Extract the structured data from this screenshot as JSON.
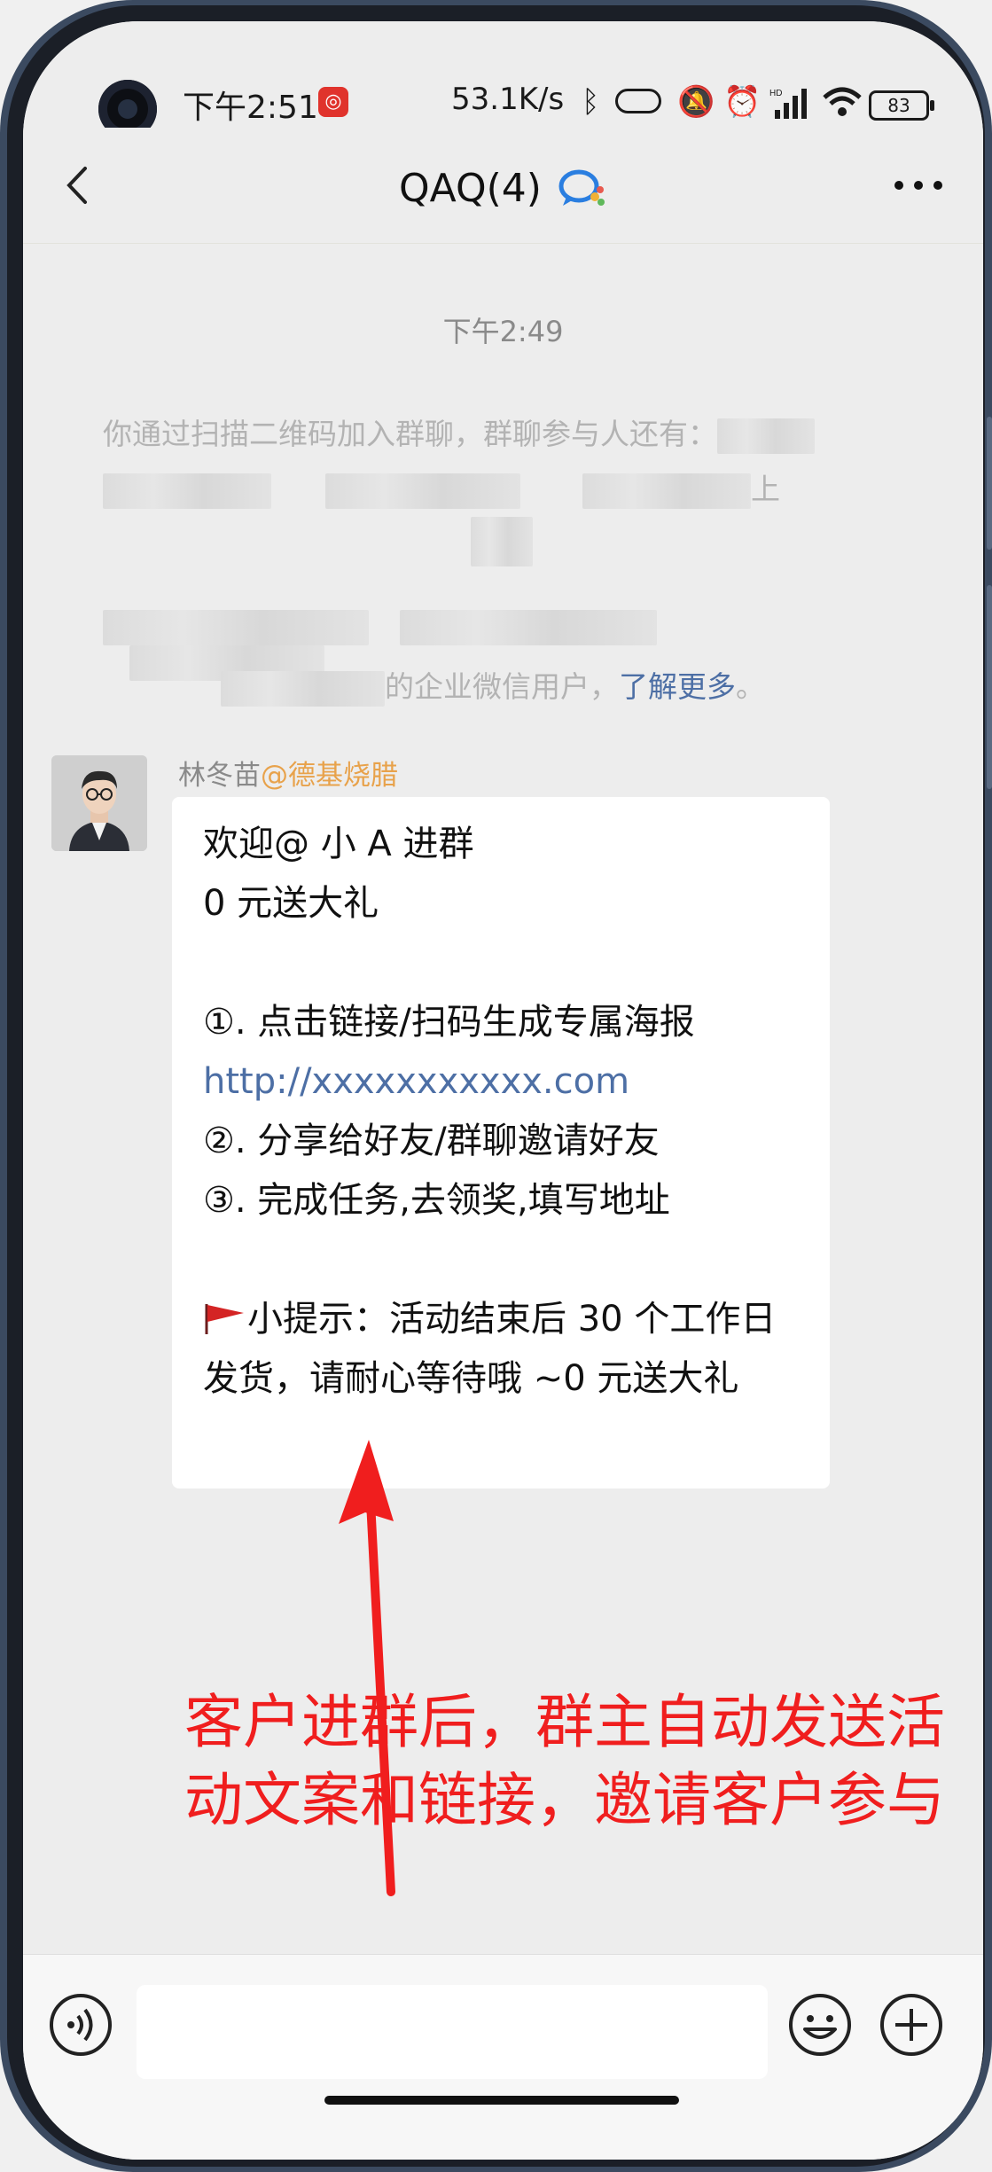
{
  "status_bar": {
    "time": "下午2:51",
    "net_speed": "53.1K/s",
    "battery": "83",
    "icons": [
      "camera-icon",
      "netease-music-icon",
      "bluetooth-icon",
      "vibrate-icon",
      "mute-icon",
      "alarm-icon",
      "signal-icon",
      "wifi-icon",
      "battery-icon"
    ]
  },
  "header": {
    "title": "QAQ(4)",
    "icons": [
      "back-icon",
      "wecom-icon",
      "more-icon"
    ]
  },
  "chat": {
    "timestamp": "下午2:49",
    "system_message": {
      "line1": "你通过扫描二维码加入群聊，群聊参与人还有：",
      "line2_tail": "上",
      "line3_text": "的企业微信用户，",
      "learn_more": "了解更多",
      "period": "。"
    },
    "message": {
      "sender_name": "林冬苗",
      "sender_corp": "@德基烧腊",
      "lines": {
        "l1": "欢迎@ 小 A 进群",
        "l2": "0 元送大礼",
        "l3": "①. 点击链接/扫码生成专属海报",
        "link": "http://xxxxxxxxxxx.com",
        "l4": "②. 分享给好友/群聊邀请好友",
        "l5": "③. 完成任务,去领奖,填写地址",
        "tip": "小提示：活动结束后 30 个工作日发货，请耐心等待哦 ~0 元送大礼"
      }
    },
    "annotation": {
      "line1": "客户进群后，群主自动发送活",
      "line2": "动文案和链接，邀请客户参与",
      "color": "#f01e1e"
    }
  },
  "input_bar": {
    "placeholder": "",
    "icons": [
      "voice-icon",
      "emoji-icon",
      "plus-icon"
    ]
  },
  "colors": {
    "link": "#4d6fa5",
    "corp": "#e8a24b",
    "background": "#ededed"
  }
}
